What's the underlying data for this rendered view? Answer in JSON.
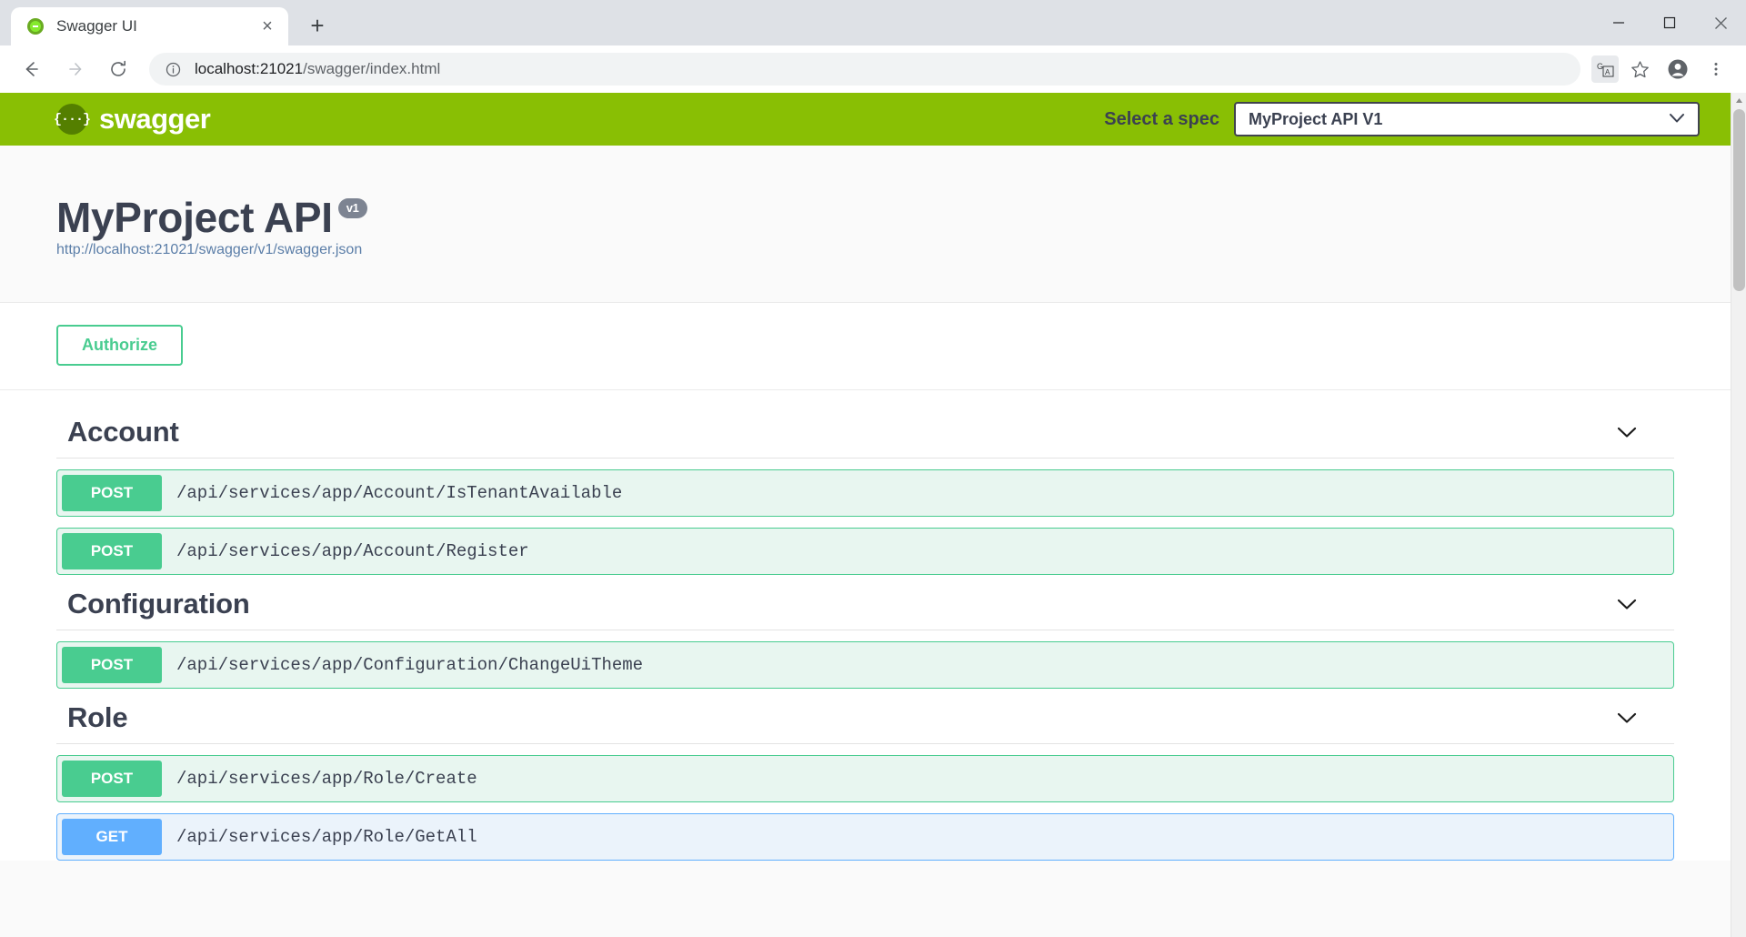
{
  "browser": {
    "tab": {
      "title": "Swagger UI",
      "favicon_icon": "swagger-favicon",
      "close_icon": "×"
    },
    "new_tab_icon": "+",
    "window_controls": {
      "minimize": "—",
      "maximize": "❐",
      "close": "✕"
    },
    "nav": {
      "back_icon": "←",
      "forward_icon": "→",
      "reload_icon": "↻"
    },
    "omnibox": {
      "info_icon": "ⓘ",
      "url_host": "localhost:21021",
      "url_path": "/swagger/index.html"
    },
    "tools": {
      "translate_icon": "Gₐ",
      "bookmark_icon": "☆",
      "profile_icon": "●",
      "menu_icon": "⋮"
    }
  },
  "topbar": {
    "logo_glyph": "{···}",
    "logo_text": "swagger",
    "spec_label": "Select a spec",
    "spec_selected": "MyProject API V1",
    "spec_chevron": "⌄",
    "bg_color": "#89bf04"
  },
  "info": {
    "title": "MyProject API",
    "version_badge": "v1",
    "spec_url": "http://localhost:21021/swagger/v1/swagger.json"
  },
  "auth": {
    "authorize_label": "Authorize",
    "accent_color": "#49cc90"
  },
  "sections": [
    {
      "name": "Account",
      "chevron": "⌄",
      "operations": [
        {
          "method": "POST",
          "method_class": "post",
          "path": "/api/services/app/Account/IsTenantAvailable",
          "color": "#49cc90"
        },
        {
          "method": "POST",
          "method_class": "post",
          "path": "/api/services/app/Account/Register",
          "color": "#49cc90"
        }
      ]
    },
    {
      "name": "Configuration",
      "chevron": "⌄",
      "operations": [
        {
          "method": "POST",
          "method_class": "post",
          "path": "/api/services/app/Configuration/ChangeUiTheme",
          "color": "#49cc90"
        }
      ]
    },
    {
      "name": "Role",
      "chevron": "⌄",
      "operations": [
        {
          "method": "POST",
          "method_class": "post",
          "path": "/api/services/app/Role/Create",
          "color": "#49cc90"
        },
        {
          "method": "GET",
          "method_class": "get",
          "path": "/api/services/app/Role/GetAll",
          "color": "#61affe"
        }
      ]
    }
  ]
}
